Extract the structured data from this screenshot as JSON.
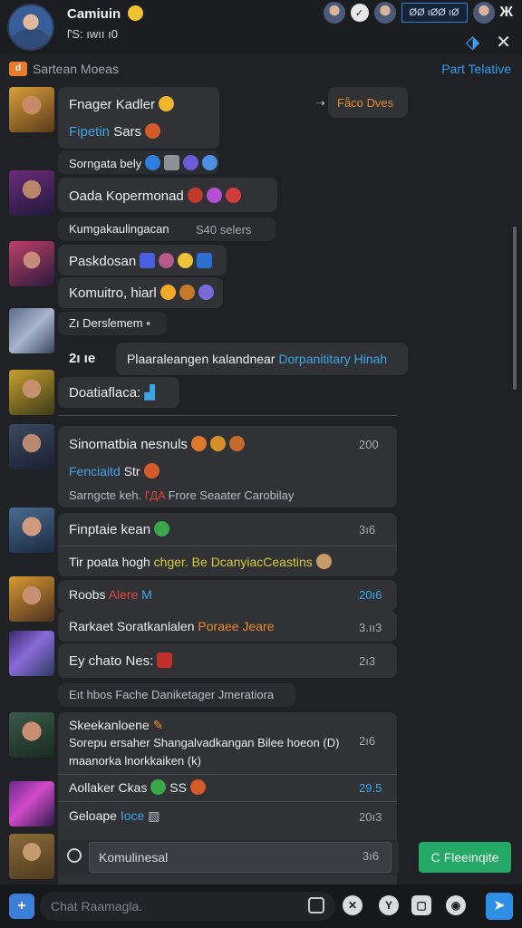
{
  "header": {
    "name": "Camiuin",
    "status": "ſ'S: ıwıı ı0",
    "tab_label": "ØØ ıØØ ıØ",
    "close_x": "Ж"
  },
  "channel": {
    "badge": "d",
    "name": "Sartean Moeas",
    "link": "Part Telative"
  },
  "messages": {
    "m1_line1": "Fnager Kadler",
    "m1_line2": "Fipetin",
    "m1_line2b": "Sars",
    "m1_side": "Fǟco Dves",
    "m1_react": "Sorngata bely",
    "m2_line1": "Oada Kopermonad",
    "m2_sub": "Kumgakaulingacan",
    "m2_sub_time": "S40 selers",
    "m3_line1": "Paskdosan",
    "m3_line2": "Komuitro, hiarl",
    "m4_line1": "Zı Dersſemem",
    "m5_time": "2ı ıe",
    "m5_text": "Plaaraleangen kalandnear",
    "m5_link": "Dorpanititary Hinah",
    "m6_line1": "Doatiaflaca:",
    "m7_line1": "Sinomatbia nesnuls",
    "m7_time": "200",
    "m7_line2": "Fenciaitd",
    "m7_line2b": "Str",
    "m7_line3": "Sarngcte keh.",
    "m7_line3_red": "ſ'ДA",
    "m7_line3b": "Frore Seaater Carobilay",
    "m8_line1": "Finptaie kean",
    "m8_time": "3ı6",
    "m8_line2": "Tir poata hogh",
    "m8_line2_y": "chger. Be DcanyiacCeastins",
    "m9_line1": "Roobs",
    "m9_line1_red": "Alere",
    "m9_line1_blue": "M",
    "m9_time": "20ı6",
    "m10_line1": "Rarkaet Soratkanlalen",
    "m10_line1_orange": "Poraee Jeare",
    "m10_time": "3.ıı3",
    "m11_line1": "Ey chato Nes:",
    "m11_time": "2ı3",
    "sys_note": "Eıt hbos Fache Daniketager Jmeratiora",
    "m12_line1": "Skeekanloene",
    "m12_line2": "Sorepu ersaher Shangalvadkangan Bilee hoeon (D)",
    "m12_line3": "maanorka lnorkkaiken (k)",
    "m12_time": "2ı6",
    "m13_line1": "Aollaker Ckas",
    "m13_line1b": "SS",
    "m13_time": "29.5",
    "m14_line1": "Geloape",
    "m14_line1_blue": "Ioce",
    "m14_time": "20ı3"
  },
  "reply": {
    "placeholder": "Komulinesal",
    "time": "3ı6",
    "send_label": "Fleeinqite",
    "send_icon": "C"
  },
  "composer": {
    "placeholder": "Chat Raamagla.",
    "plus": "+",
    "send": "➤"
  },
  "colors": {
    "accent": "#2f9df2",
    "send_green": "#24a865",
    "bubble": "#303236",
    "background": "#1f2124"
  }
}
